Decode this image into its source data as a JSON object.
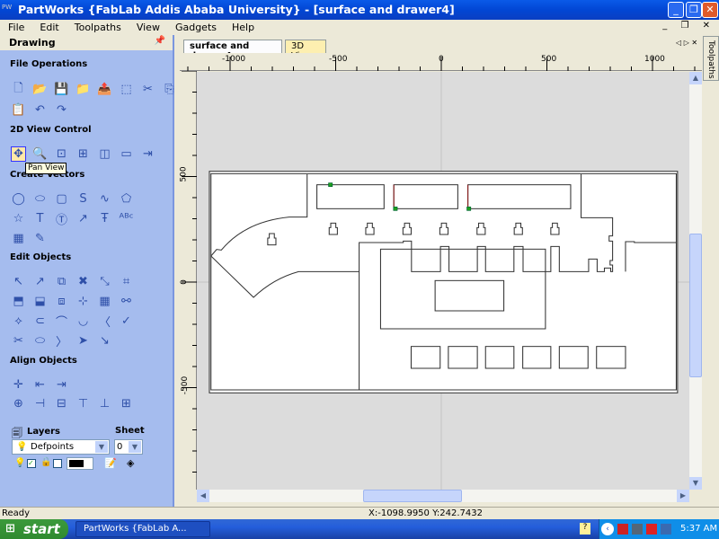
{
  "window": {
    "title": "PartWorks {FabLab Addis Ababa University} - [surface and drawer4]",
    "app_icon": "PW"
  },
  "menu": [
    "File",
    "Edit",
    "Toolpaths",
    "View",
    "Gadgets",
    "Help"
  ],
  "panel": {
    "title": "Drawing",
    "sections": {
      "file": "File Operations",
      "view": "2D View Control",
      "create": "Create Vectors",
      "edit": "Edit Objects",
      "align": "Align Objects"
    },
    "tooltip": "Pan View",
    "layers_label": "Layers",
    "sheet_label": "Sheet",
    "layer_value": "Defpoints",
    "sheet_value": "0",
    "icons": {
      "file": [
        [
          "new-file-icon",
          "🗋"
        ],
        [
          "open-folder-icon",
          "📂"
        ],
        [
          "save-icon",
          "💾"
        ],
        [
          "save-as-icon",
          "📁"
        ],
        [
          "import-icon",
          "📤"
        ],
        [
          "select-all-icon",
          "⬚"
        ],
        [
          "cut-icon",
          "✂"
        ],
        [
          "copy-icon",
          "⎘"
        ],
        [
          "paste-icon",
          "📋"
        ],
        [
          "undo-icon",
          "↶"
        ],
        [
          "redo-icon",
          "↷"
        ]
      ],
      "view": [
        [
          "pan-icon",
          "✥"
        ],
        [
          "zoom-icon",
          "🔍"
        ],
        [
          "zoom-extents-icon",
          "⊡"
        ],
        [
          "zoom-box-icon",
          "⊞"
        ],
        [
          "view-icon-5",
          "◫"
        ],
        [
          "view-icon-6",
          "▭"
        ],
        [
          "view-icon-7",
          "⇥"
        ]
      ],
      "create": [
        [
          "circle-icon",
          "◯"
        ],
        [
          "ellipse-icon",
          "⬭"
        ],
        [
          "rectangle-icon",
          "▢"
        ],
        [
          "curve-icon",
          "S"
        ],
        [
          "polyline-icon",
          "∿"
        ],
        [
          "polygon-icon",
          "⬠"
        ],
        [
          "star-icon",
          "☆"
        ],
        [
          "text-icon",
          "T"
        ],
        [
          "text-box-icon",
          "Ⓣ"
        ],
        [
          "text-on-curve-icon",
          "↗"
        ],
        [
          "text-edit-icon",
          "Ŧ"
        ],
        [
          "text-abc-icon",
          "ᴬᴮᶜ"
        ],
        [
          "array-icon",
          "▦"
        ],
        [
          "draw-icon",
          "✎"
        ]
      ],
      "edit": [
        [
          "node-edit-icon",
          "↖"
        ],
        [
          "node-select-icon",
          "↗"
        ],
        [
          "transform-icon",
          "⧉"
        ],
        [
          "delete-icon",
          "✖"
        ],
        [
          "measure-icon",
          "⤡"
        ],
        [
          "scale-icon",
          "⌗"
        ],
        [
          "distort-icon",
          "⬒"
        ],
        [
          "resize-icon",
          "⬓"
        ],
        [
          "mirror-icon",
          "⧈"
        ],
        [
          "trim-icon",
          "⊹"
        ],
        [
          "group-icon",
          "▦"
        ],
        [
          "weld-icon",
          "⚯"
        ],
        [
          "offset-icon",
          "⟡"
        ],
        [
          "join-icon",
          "⊂"
        ],
        [
          "fillet-icon",
          "⌒"
        ],
        [
          "ungroup-icon",
          "◡"
        ],
        [
          "angle-icon",
          "〈"
        ],
        [
          "check-icon",
          "✓"
        ],
        [
          "scissors-icon",
          "✂"
        ],
        [
          "boundary-icon",
          "⬭"
        ],
        [
          "open-vector-icon",
          "〉"
        ],
        [
          "arrow-icon",
          "➤"
        ],
        [
          "arrow-down-icon",
          "↘"
        ]
      ],
      "align": [
        [
          "align-center-icon",
          "✛"
        ],
        [
          "align-left-icon",
          "⇤"
        ],
        [
          "align-right-icon",
          "⇥"
        ],
        [
          "align-c1-icon",
          "⊕"
        ],
        [
          "align-left2-icon",
          "⊣"
        ],
        [
          "align-mid-icon",
          "⊟"
        ],
        [
          "align-top-icon",
          "⊤"
        ],
        [
          "align-bottom-icon",
          "⊥"
        ],
        [
          "align-hcenter-icon",
          "⊞"
        ],
        [
          "align-vcenter-icon",
          "⊡"
        ]
      ]
    }
  },
  "tabs": {
    "active": "surface and drawer4",
    "other": "3D View"
  },
  "side_tab": "Toolpaths",
  "ruler": {
    "top": [
      "-1000",
      "-500",
      "0",
      "500",
      "1000"
    ],
    "left": [
      "500",
      "0",
      "-500"
    ]
  },
  "status": {
    "text": "Ready",
    "coords": "X:-1098.9950 Y:242.7432"
  },
  "taskbar": {
    "start": "start",
    "task": "PartWorks {FabLab A...",
    "clock": "5:37 AM"
  }
}
